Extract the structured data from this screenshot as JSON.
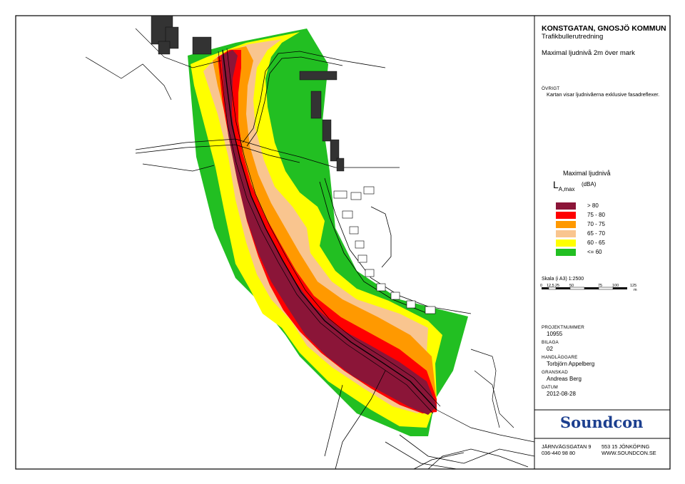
{
  "title": {
    "project": "KONSTGATAN, GNOSJÖ KOMMUN",
    "subtitle": "Trafikbullerutredning",
    "map_title": "Maximal ljudnivå 2m över mark"
  },
  "notes": {
    "label": "ÖVRIGT",
    "text": "Kartan visar ljudnivåerna exklusive fasadreflexer."
  },
  "legend": {
    "title": "Maximal ljudnivå",
    "symbol_main": "L",
    "symbol_sub": "A,max",
    "unit": "(dBA)",
    "items": [
      {
        "range": ">   80",
        "color": "#8b1538"
      },
      {
        "range": "75 -   80",
        "color": "#ff0000"
      },
      {
        "range": "70 -   75",
        "color": "#ff9900"
      },
      {
        "range": "65 -   70",
        "color": "#f9c58f"
      },
      {
        "range": "60 -   65",
        "color": "#ffff00"
      },
      {
        "range": "<= 60",
        "color": "#22bf22"
      }
    ]
  },
  "scale": {
    "label": "Skala (i A3) 1:2500",
    "ticks": [
      "0",
      "12,5",
      "25",
      "50",
      "75",
      "100",
      "125"
    ],
    "unit": "m"
  },
  "project_info": {
    "projektnummer_label": "PROJEKTNUMMER",
    "projektnummer": "10955",
    "bilaga_label": "BILAGA",
    "bilaga": "02",
    "handlaggare_label": "HANDLÄGGARE",
    "handlaggare": "Torbjörn Appelberg",
    "granskad_label": "GRANSKAD",
    "granskad": "Andreas Berg",
    "datum_label": "DATUM",
    "datum": "2012-08-28"
  },
  "company": {
    "logo": "Soundcon",
    "address": "JÄRNVÄGSGATAN 9",
    "postal": "553 15 JÖNKÖPING",
    "phone": "036-440 98 80",
    "web": "WWW.SOUNDCON.SE"
  }
}
